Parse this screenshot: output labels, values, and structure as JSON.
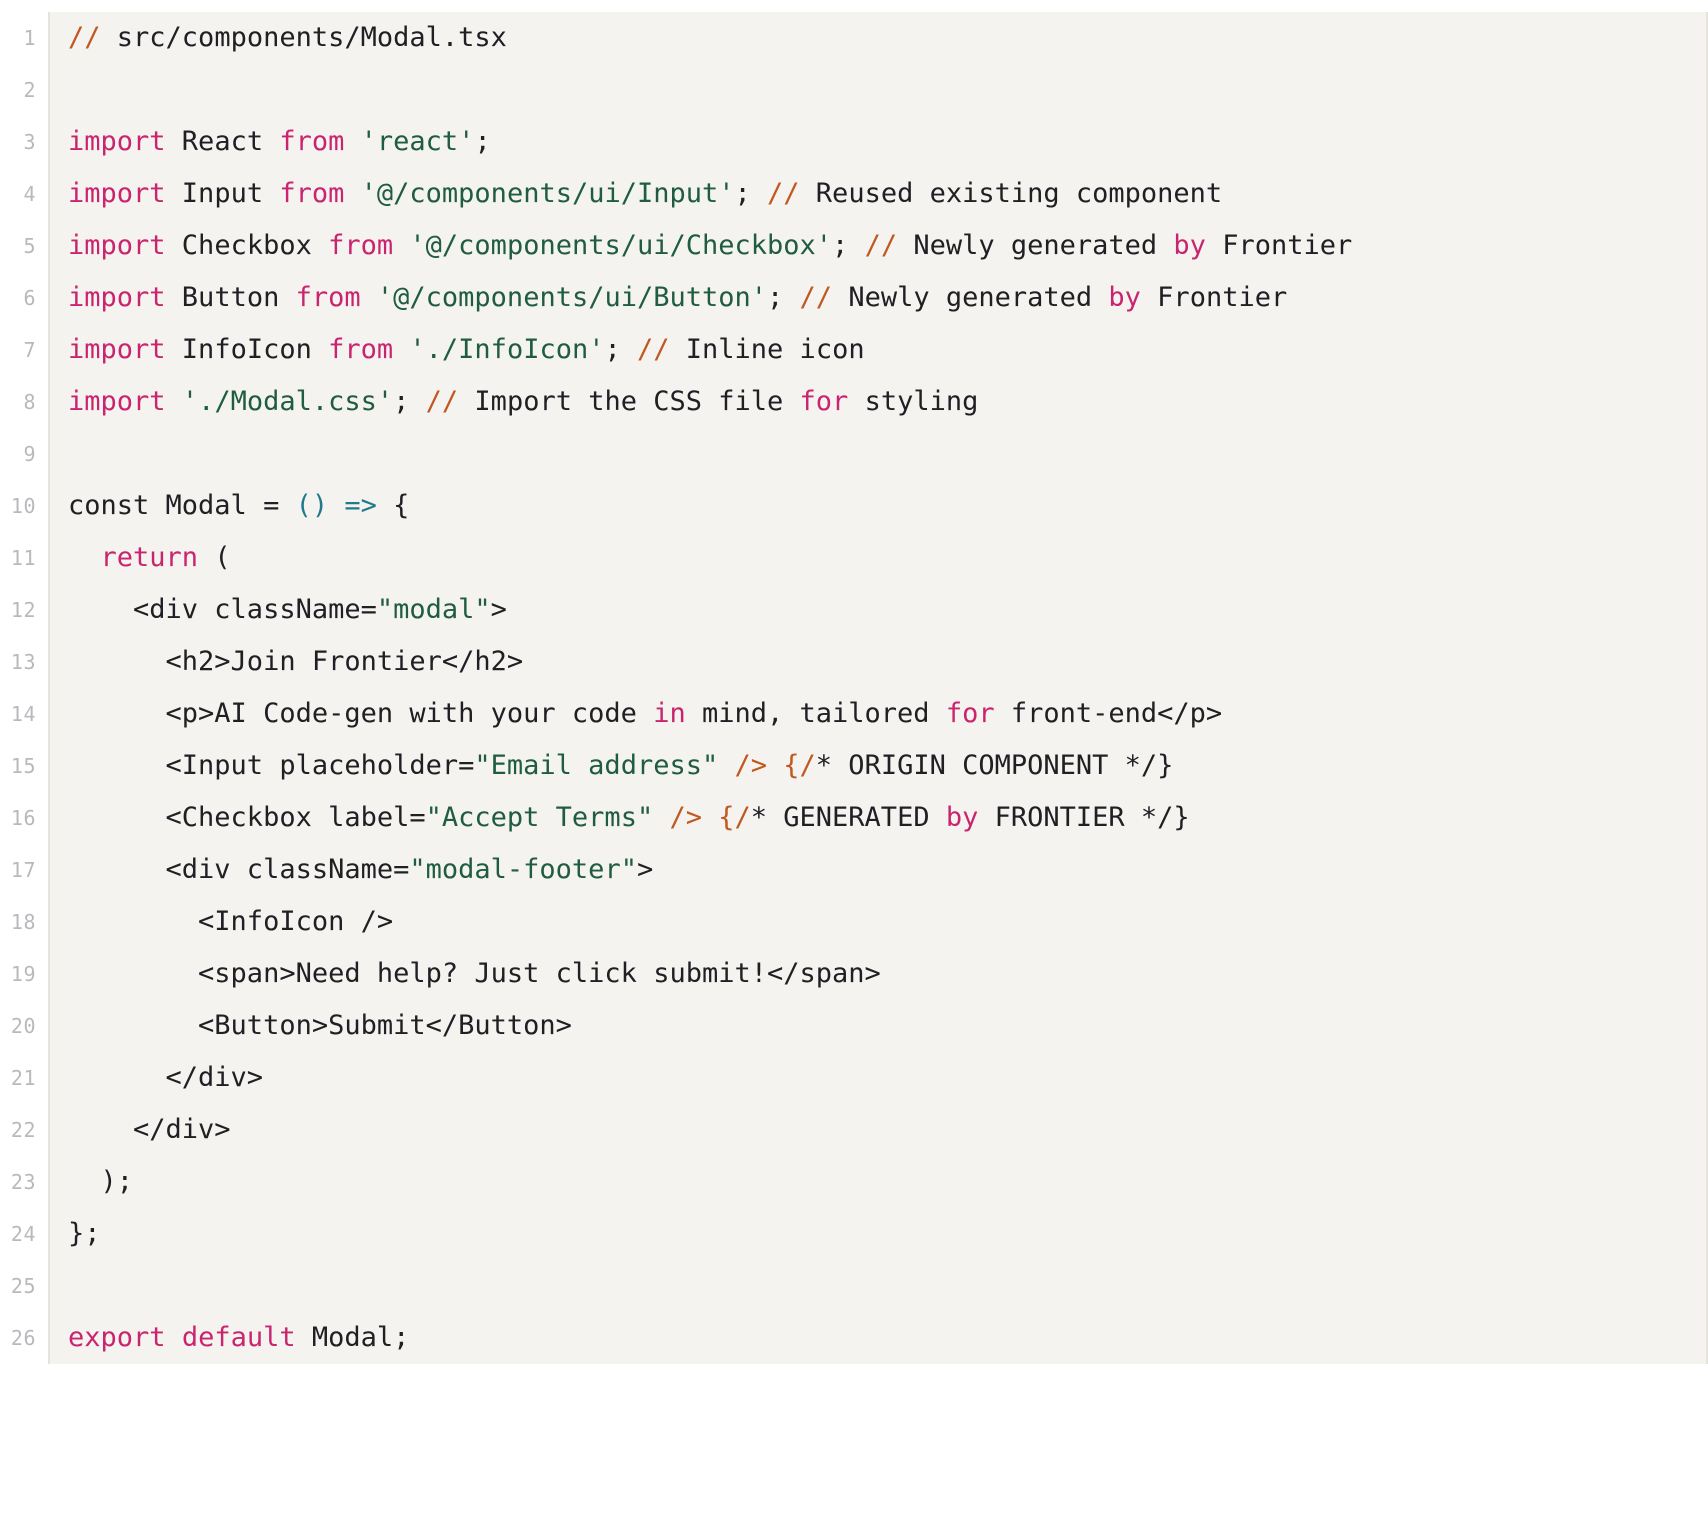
{
  "editor": {
    "language": "tsx",
    "file_name": "Modal.tsx",
    "first_line_number": 1,
    "last_line_number": 26,
    "total_lines": 26,
    "background_color": "#f5f3f0",
    "page_background_color": "#ffffff",
    "gutter_text_color": "#b9b9bd",
    "border_color": "#e6e2dc"
  },
  "theme": {
    "name": "light-warm",
    "keyword_color": "#c9256f",
    "string_color": "#205c40",
    "comment_marker_color": "#c1581f",
    "punctuation_color": "#1f7a8c",
    "text_color": "#202024"
  },
  "lines": [
    {
      "number": "1",
      "tokens": [
        {
          "text": "// ",
          "kind": "com"
        },
        {
          "text": "src/components/Modal.tsx",
          "kind": "txt"
        }
      ]
    },
    {
      "number": "2",
      "tokens": []
    },
    {
      "number": "3",
      "tokens": [
        {
          "text": "import",
          "kind": "kw"
        },
        {
          "text": " React ",
          "kind": "txt"
        },
        {
          "text": "from",
          "kind": "kw"
        },
        {
          "text": " ",
          "kind": "txt"
        },
        {
          "text": "'react'",
          "kind": "str"
        },
        {
          "text": ";",
          "kind": "txt"
        }
      ]
    },
    {
      "number": "4",
      "tokens": [
        {
          "text": "import",
          "kind": "kw"
        },
        {
          "text": " Input ",
          "kind": "txt"
        },
        {
          "text": "from",
          "kind": "kw"
        },
        {
          "text": " ",
          "kind": "txt"
        },
        {
          "text": "'@/components/ui/Input'",
          "kind": "str"
        },
        {
          "text": "; ",
          "kind": "txt"
        },
        {
          "text": "//",
          "kind": "com"
        },
        {
          "text": " Reused existing component",
          "kind": "txt"
        }
      ]
    },
    {
      "number": "5",
      "tokens": [
        {
          "text": "import",
          "kind": "kw"
        },
        {
          "text": " Checkbox ",
          "kind": "txt"
        },
        {
          "text": "from",
          "kind": "kw"
        },
        {
          "text": " ",
          "kind": "txt"
        },
        {
          "text": "'@/components/ui/Checkbox'",
          "kind": "str"
        },
        {
          "text": "; ",
          "kind": "txt"
        },
        {
          "text": "//",
          "kind": "com"
        },
        {
          "text": " Newly generated ",
          "kind": "txt"
        },
        {
          "text": "by",
          "kind": "kw"
        },
        {
          "text": " Frontier",
          "kind": "txt"
        }
      ]
    },
    {
      "number": "6",
      "tokens": [
        {
          "text": "import",
          "kind": "kw"
        },
        {
          "text": " Button ",
          "kind": "txt"
        },
        {
          "text": "from",
          "kind": "kw"
        },
        {
          "text": " ",
          "kind": "txt"
        },
        {
          "text": "'@/components/ui/Button'",
          "kind": "str"
        },
        {
          "text": "; ",
          "kind": "txt"
        },
        {
          "text": "//",
          "kind": "com"
        },
        {
          "text": " Newly generated ",
          "kind": "txt"
        },
        {
          "text": "by",
          "kind": "kw"
        },
        {
          "text": " Frontier",
          "kind": "txt"
        }
      ]
    },
    {
      "number": "7",
      "tokens": [
        {
          "text": "import",
          "kind": "kw"
        },
        {
          "text": " InfoIcon ",
          "kind": "txt"
        },
        {
          "text": "from",
          "kind": "kw"
        },
        {
          "text": " ",
          "kind": "txt"
        },
        {
          "text": "'./InfoIcon'",
          "kind": "str"
        },
        {
          "text": "; ",
          "kind": "txt"
        },
        {
          "text": "//",
          "kind": "com"
        },
        {
          "text": " Inline icon",
          "kind": "txt"
        }
      ]
    },
    {
      "number": "8",
      "tokens": [
        {
          "text": "import",
          "kind": "kw"
        },
        {
          "text": " ",
          "kind": "txt"
        },
        {
          "text": "'./Modal.css'",
          "kind": "str"
        },
        {
          "text": "; ",
          "kind": "txt"
        },
        {
          "text": "//",
          "kind": "com"
        },
        {
          "text": " Import the CSS file ",
          "kind": "txt"
        },
        {
          "text": "for",
          "kind": "kw"
        },
        {
          "text": " styling",
          "kind": "txt"
        }
      ]
    },
    {
      "number": "9",
      "tokens": []
    },
    {
      "number": "10",
      "tokens": [
        {
          "text": "const Modal = ",
          "kind": "txt"
        },
        {
          "text": "()",
          "kind": "punc"
        },
        {
          "text": " ",
          "kind": "txt"
        },
        {
          "text": "=>",
          "kind": "punc"
        },
        {
          "text": " {",
          "kind": "txt"
        }
      ]
    },
    {
      "number": "11",
      "tokens": [
        {
          "text": "  ",
          "kind": "txt"
        },
        {
          "text": "return",
          "kind": "kw"
        },
        {
          "text": " (",
          "kind": "txt"
        }
      ]
    },
    {
      "number": "12",
      "tokens": [
        {
          "text": "    <div className=",
          "kind": "txt"
        },
        {
          "text": "\"modal\"",
          "kind": "str"
        },
        {
          "text": ">",
          "kind": "txt"
        }
      ]
    },
    {
      "number": "13",
      "tokens": [
        {
          "text": "      <h2>Join Frontier</h2>",
          "kind": "txt"
        }
      ]
    },
    {
      "number": "14",
      "tokens": [
        {
          "text": "      <p>AI Code-gen with your code ",
          "kind": "txt"
        },
        {
          "text": "in",
          "kind": "kw"
        },
        {
          "text": " mind, tailored ",
          "kind": "txt"
        },
        {
          "text": "for",
          "kind": "kw"
        },
        {
          "text": " front-end</p>",
          "kind": "txt"
        }
      ]
    },
    {
      "number": "15",
      "tokens": [
        {
          "text": "      <Input placeholder=",
          "kind": "txt"
        },
        {
          "text": "\"Email address\"",
          "kind": "str"
        },
        {
          "text": " ",
          "kind": "txt"
        },
        {
          "text": "/>",
          "kind": "com"
        },
        {
          "text": " ",
          "kind": "txt"
        },
        {
          "text": "{/",
          "kind": "com"
        },
        {
          "text": "* ORIGIN COMPONENT */}",
          "kind": "txt"
        }
      ]
    },
    {
      "number": "16",
      "tokens": [
        {
          "text": "      <Checkbox label=",
          "kind": "txt"
        },
        {
          "text": "\"Accept Terms\"",
          "kind": "str"
        },
        {
          "text": " ",
          "kind": "txt"
        },
        {
          "text": "/>",
          "kind": "com"
        },
        {
          "text": " ",
          "kind": "txt"
        },
        {
          "text": "{/",
          "kind": "com"
        },
        {
          "text": "* GENERATED ",
          "kind": "txt"
        },
        {
          "text": "by",
          "kind": "kw"
        },
        {
          "text": " FRONTIER */}",
          "kind": "txt"
        }
      ]
    },
    {
      "number": "17",
      "tokens": [
        {
          "text": "      <div className=",
          "kind": "txt"
        },
        {
          "text": "\"modal-footer\"",
          "kind": "str"
        },
        {
          "text": ">",
          "kind": "txt"
        }
      ]
    },
    {
      "number": "18",
      "tokens": [
        {
          "text": "        <InfoIcon />",
          "kind": "txt"
        }
      ]
    },
    {
      "number": "19",
      "tokens": [
        {
          "text": "        <span>Need help? Just click submit!</span>",
          "kind": "txt"
        }
      ]
    },
    {
      "number": "20",
      "tokens": [
        {
          "text": "        <Button>Submit</Button>",
          "kind": "txt"
        }
      ]
    },
    {
      "number": "21",
      "tokens": [
        {
          "text": "      </div>",
          "kind": "txt"
        }
      ]
    },
    {
      "number": "22",
      "tokens": [
        {
          "text": "    </div>",
          "kind": "txt"
        }
      ]
    },
    {
      "number": "23",
      "tokens": [
        {
          "text": "  );",
          "kind": "txt"
        }
      ]
    },
    {
      "number": "24",
      "tokens": [
        {
          "text": "};",
          "kind": "txt"
        }
      ]
    },
    {
      "number": "25",
      "tokens": []
    },
    {
      "number": "26",
      "tokens": [
        {
          "text": "export",
          "kind": "kw"
        },
        {
          "text": " ",
          "kind": "txt"
        },
        {
          "text": "default",
          "kind": "kw"
        },
        {
          "text": " Modal;",
          "kind": "txt"
        }
      ]
    }
  ]
}
